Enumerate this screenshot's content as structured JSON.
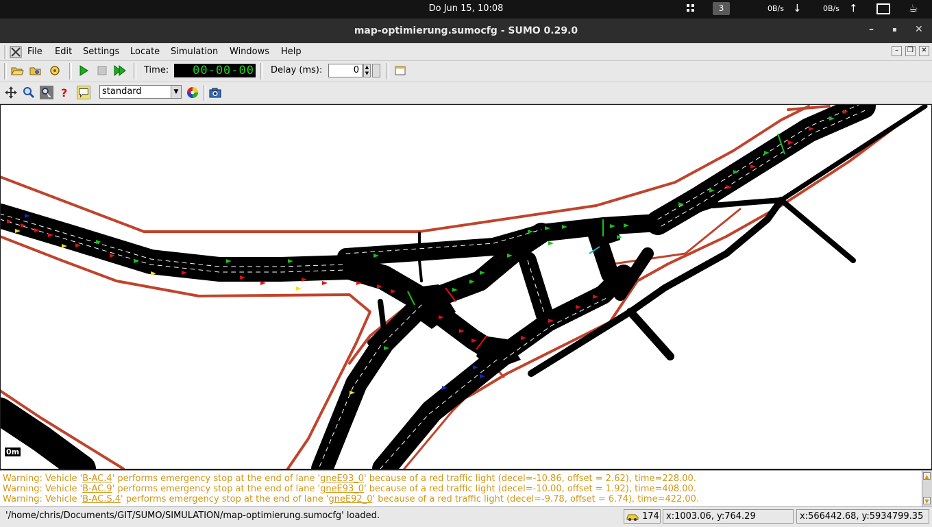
{
  "topbar": {
    "clock": "Do Jun 15, 10:08",
    "workspace": "3",
    "net_down": "0B/s",
    "net_up": "0B/s"
  },
  "window": {
    "title": "map-optimierung.sumocfg - SUMO 0.29.0",
    "minimize": "–",
    "maximize": "▪",
    "close": "✕"
  },
  "menu": {
    "file": "File",
    "edit": "Edit",
    "settings": "Settings",
    "locate": "Locate",
    "simulation": "Simulation",
    "windows": "Windows",
    "help": "Help"
  },
  "toolbar": {
    "time_label": "Time:",
    "time_value": "00-00-00",
    "delay_label": "Delay (ms):",
    "delay_value": "0",
    "scheme_selected": "standard"
  },
  "map": {
    "scale_label": "0m"
  },
  "messages": [
    {
      "pre": "Warning: Vehicle '",
      "vehicle": "B-AC.4",
      "mid": "' performs emergency stop at the end of lane '",
      "lane": "gneE93_0",
      "post": "' because of a red traffic light (decel=-10.86, offset = 2.62), time=228.00."
    },
    {
      "pre": "Warning: Vehicle '",
      "vehicle": "B-AC.9",
      "mid": "' performs emergency stop at the end of lane '",
      "lane": "gneE93_0",
      "post": "' because of a red traffic light (decel=-10.00, offset = 1.92), time=408.00."
    },
    {
      "pre": "Warning: Vehicle '",
      "vehicle": "B-AC.S.4",
      "mid": "' performs emergency stop at the end of lane '",
      "lane": "gneE92_0",
      "post": "' because of a red traffic light (decel=-9.78, offset = 6.74), time=422.00."
    }
  ],
  "status": {
    "message": "'/home/chris/Documents/GIT/SUMO/SIMULATION/map-optimierung.sumocfg' loaded.",
    "vehicle_count": "174",
    "cursor_xy": "x:1003.06, y:764.29",
    "geo_xy": "x:566442.68, y:5934799.35"
  },
  "colors": {
    "road": "#000000",
    "sidewalk": "#c0442c",
    "vehicle_red": "#e01010",
    "vehicle_green": "#18c018",
    "vehicle_yellow": "#f0e020",
    "vehicle_blue": "#1828c0",
    "time_digits": "#18d418",
    "warning_text": "#d09818"
  }
}
